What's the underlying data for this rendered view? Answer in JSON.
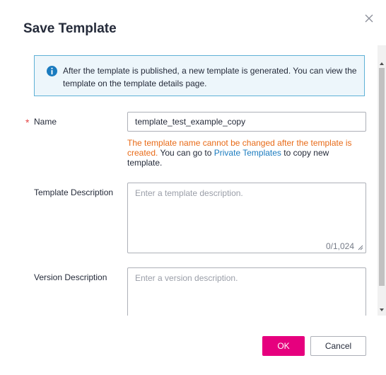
{
  "dialog": {
    "title": "Save Template",
    "close_icon": "close-icon"
  },
  "alert": {
    "icon": "info-icon",
    "text": "After the template is published, a new template is generated. You can view the template on the template details page."
  },
  "form": {
    "name": {
      "label": "Name",
      "required_mark": "*",
      "value": "template_test_example_copy",
      "hint_warning": "The template name cannot be changed after the template is created.",
      "hint_mid": " You can go to ",
      "hint_link": "Private Templates",
      "hint_tail": " to copy new template."
    },
    "template_description": {
      "label": "Template Description",
      "placeholder": "Enter a template description.",
      "counter": "0/1,024"
    },
    "version_description": {
      "label": "Version Description",
      "placeholder": "Enter a version description."
    }
  },
  "footer": {
    "ok_label": "OK",
    "cancel_label": "Cancel"
  },
  "colors": {
    "primary": "#e6007e",
    "warning": "#e86a17",
    "link": "#1a7bbf",
    "info_border": "#5fb1d6"
  }
}
